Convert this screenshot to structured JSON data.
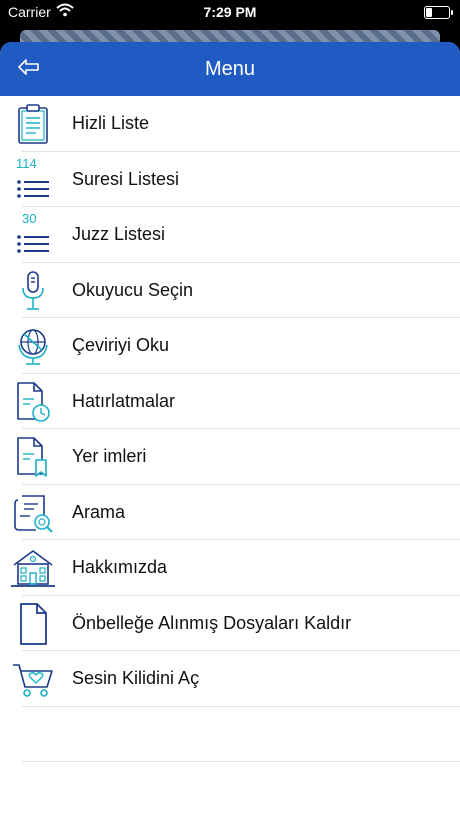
{
  "status": {
    "carrier": "Carrier",
    "time": "7:29 PM"
  },
  "header": {
    "title": "Menu",
    "back_icon": "back-arrow-icon"
  },
  "menu": {
    "items": [
      {
        "label": "Hizli Liste",
        "icon": "clipboard-list-icon"
      },
      {
        "label": "Suresi Listesi",
        "icon": "list-icon",
        "count": "114"
      },
      {
        "label": "Juzz Listesi",
        "icon": "list-icon",
        "count": "30"
      },
      {
        "label": "Okuyucu Seçin",
        "icon": "microphone-icon"
      },
      {
        "label": "Çeviriyi Oku",
        "icon": "globe-icon"
      },
      {
        "label": "Hatırlatmalar",
        "icon": "document-clock-icon"
      },
      {
        "label": "Yer imleri",
        "icon": "document-bookmark-icon"
      },
      {
        "label": "Arama",
        "icon": "search-document-icon"
      },
      {
        "label": "Hakkımızda",
        "icon": "building-icon"
      },
      {
        "label": "Önbelleğe Alınmış Dosyaları Kaldır",
        "icon": "file-icon"
      },
      {
        "label": "Sesin Kilidini Aç",
        "icon": "shopping-cart-icon"
      }
    ]
  },
  "colors": {
    "accent": "#1f5bc2",
    "icon_teal": "#1ab0c8",
    "icon_navy": "#1d3a8a"
  }
}
